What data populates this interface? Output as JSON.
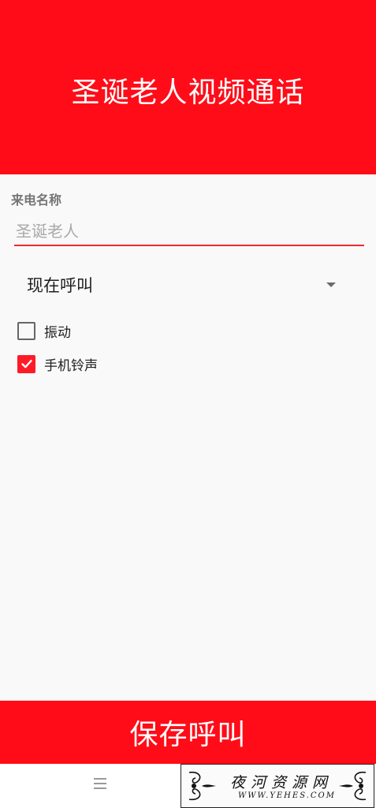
{
  "header": {
    "title": "圣诞老人视频通话"
  },
  "form": {
    "caller_name_label": "来电名称",
    "caller_name_placeholder": "圣诞老人",
    "call_time_selected": "现在呼叫",
    "options": [
      {
        "label": "振动",
        "checked": false
      },
      {
        "label": "手机铃声",
        "checked": true
      }
    ]
  },
  "save_button_label": "保存呼叫",
  "watermark": {
    "cn": "夜河资源网",
    "en": "WWW.YEHES.COM"
  },
  "colors": {
    "accent": "#ff0c18",
    "underline": "#ef2a2f"
  },
  "icons": {
    "menu": "menu-icon",
    "dropdown": "dropdown-arrow-icon",
    "check": "check-icon"
  }
}
